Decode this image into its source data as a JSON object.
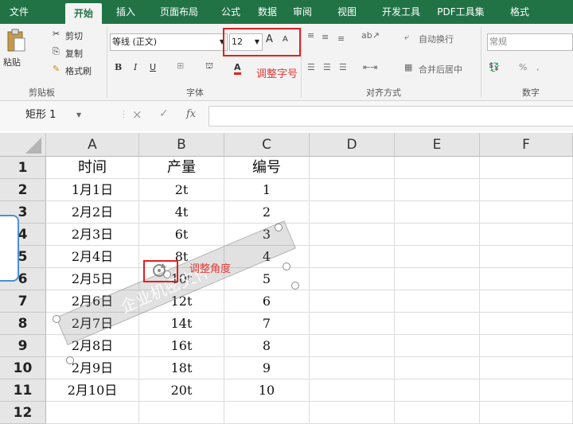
{
  "tabs": [
    "文件",
    "开始",
    "插入",
    "页面布局",
    "公式",
    "数据",
    "审阅",
    "视图",
    "开发工具",
    "PDF工具集",
    "格式"
  ],
  "clipboard": {
    "paste": "粘贴",
    "cut": "剪切",
    "copy": "复制",
    "format_painter": "格式刷",
    "group": "剪贴板"
  },
  "font": {
    "name": "等线 (正文)",
    "size": "12",
    "grow": "A",
    "shrink": "A",
    "bold": "B",
    "italic": "I",
    "underline": "U",
    "group": "字体"
  },
  "alignment": {
    "wrap": "自动换行",
    "merge": "合并后居中",
    "group": "对齐方式"
  },
  "number": {
    "format": "常规",
    "percent": "%",
    "group": "数字"
  },
  "annotations": {
    "font_size": "调整字号",
    "angle": "调整角度"
  },
  "formula_bar": {
    "name_box": "矩形 1",
    "fx": "fx",
    "cancel": "×",
    "enter": "✓"
  },
  "columns": [
    "A",
    "B",
    "C",
    "D",
    "E",
    "F"
  ],
  "rows": [
    {
      "num": "1",
      "a": "时间",
      "b": "产量",
      "c": "编号"
    },
    {
      "num": "2",
      "a": "1月1日",
      "b": "2t",
      "c": "1"
    },
    {
      "num": "3",
      "a": "2月2日",
      "b": "4t",
      "c": "2"
    },
    {
      "num": "4",
      "a": "2月3日",
      "b": "6t",
      "c": "3"
    },
    {
      "num": "5",
      "a": "2月4日",
      "b": "8t",
      "c": "4"
    },
    {
      "num": "6",
      "a": "2月5日",
      "b": "10t",
      "c": "5"
    },
    {
      "num": "7",
      "a": "2月6日",
      "b": "12t",
      "c": "6"
    },
    {
      "num": "8",
      "a": "2月7日",
      "b": "14t",
      "c": "7"
    },
    {
      "num": "9",
      "a": "2月8日",
      "b": "16t",
      "c": "8"
    },
    {
      "num": "10",
      "a": "2月9日",
      "b": "18t",
      "c": "9"
    },
    {
      "num": "11",
      "a": "2月10日",
      "b": "20t",
      "c": "10"
    },
    {
      "num": "12",
      "a": "",
      "b": "",
      "c": ""
    }
  ],
  "shape_text": "企业机密文件",
  "colors": {
    "ribbon_green": "#217346",
    "annotation_red": "#e02020"
  }
}
